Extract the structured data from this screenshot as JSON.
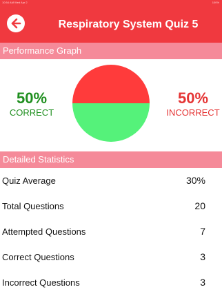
{
  "statusbar": {
    "time": "10:54 AM Wed Apr 2",
    "battery": "100%"
  },
  "header": {
    "title": "Respiratory System Quiz 5"
  },
  "performance": {
    "section_title": "Performance Graph",
    "correct_pct": "50%",
    "correct_label": "CORRECT",
    "incorrect_pct": "50%",
    "incorrect_label": "INCORRECT",
    "colors": {
      "correct": "#55f27a",
      "incorrect": "#ff3b3b"
    }
  },
  "chart_data": {
    "type": "pie",
    "categories": [
      "Correct",
      "Incorrect"
    ],
    "values": [
      50,
      50
    ]
  },
  "stats": {
    "section_title": "Detailed Statistics",
    "rows": [
      {
        "label": "Quiz Average",
        "value": "30%"
      },
      {
        "label": "Total Questions",
        "value": "20"
      },
      {
        "label": "Attempted Questions",
        "value": "7"
      },
      {
        "label": "Correct Questions",
        "value": "3"
      },
      {
        "label": "Incorrect Questions",
        "value": "3"
      }
    ]
  }
}
